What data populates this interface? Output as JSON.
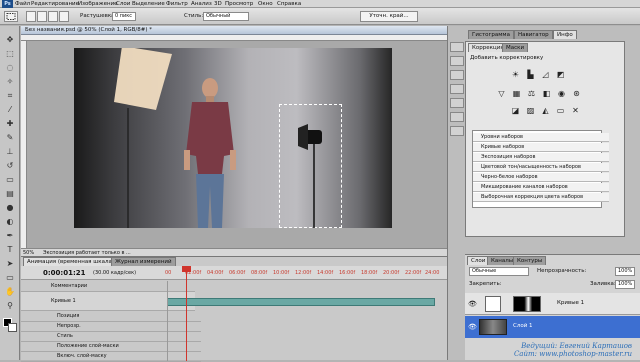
{
  "app": {
    "logo": "Ps"
  },
  "menu": [
    "Файл",
    "Редактирование",
    "Изображение",
    "Слои",
    "Выделение",
    "Фильтр",
    "Анализ",
    "3D",
    "Просмотр",
    "Окно",
    "Справка"
  ],
  "options_bar": {
    "feather_label": "Растушевка:",
    "feather_value": "0 пикс",
    "style_label": "Стиль:",
    "style_value": "Обычный",
    "refine_button": "Уточн. край..."
  },
  "document": {
    "title": "Без названия.psd @ 50% (Слой 1, RGB/8#) *",
    "zoom": "50%",
    "status": "Экспозиция работает только в ..."
  },
  "right_panel": {
    "top_tabs": [
      "Гистограмма",
      "Навигатор",
      "Инфо"
    ],
    "adj_tabs": [
      "Коррекция",
      "Маски"
    ],
    "adj_title": "Добавить корректировку",
    "presets": [
      "Уровни наборов",
      "Кривые наборов",
      "Экспозиция наборов",
      "Цветовой тон/насыщенность наборов",
      "Черно-белое наборов",
      "Микширование каналов наборов",
      "Выборочная коррекция цвета наборов"
    ]
  },
  "layers_panel": {
    "tabs": [
      "Слои",
      "Каналы",
      "Контуры"
    ],
    "blend_mode": "Обычные",
    "opacity_label": "Непрозрачность:",
    "opacity_value": "100%",
    "lock_label": "Закрепить:",
    "fill_label": "Заливка:",
    "fill_value": "100%",
    "layers": [
      {
        "name": "Кривые 1"
      },
      {
        "name": "Слой 1"
      }
    ]
  },
  "timeline": {
    "tabs": [
      "Анимация (временная шкала)",
      "Журнал измерений"
    ],
    "timecode": "0:00:01:21",
    "fps": "(30.00 кадр/сек)",
    "ticks": [
      "00",
      "02:00f",
      "04:00f",
      "06:00f",
      "08:00f",
      "10:00f",
      "12:00f",
      "14:00f",
      "16:00f",
      "18:00f",
      "20:00f",
      "22:00f",
      "24:00"
    ],
    "rows": [
      "Комментарии",
      "Кривые 1",
      "Позиция",
      "Непрозр.",
      "Стиль",
      "Положение слой-маски",
      "Включ. слой-маску"
    ]
  },
  "watermark": {
    "line1": "Ведущий: Евгений Карташов",
    "line2": "Сайт: www.photoshop-master.ru"
  },
  "colors": {
    "accent": "#2d6fb8",
    "selected_layer": "#3d6fd1"
  }
}
